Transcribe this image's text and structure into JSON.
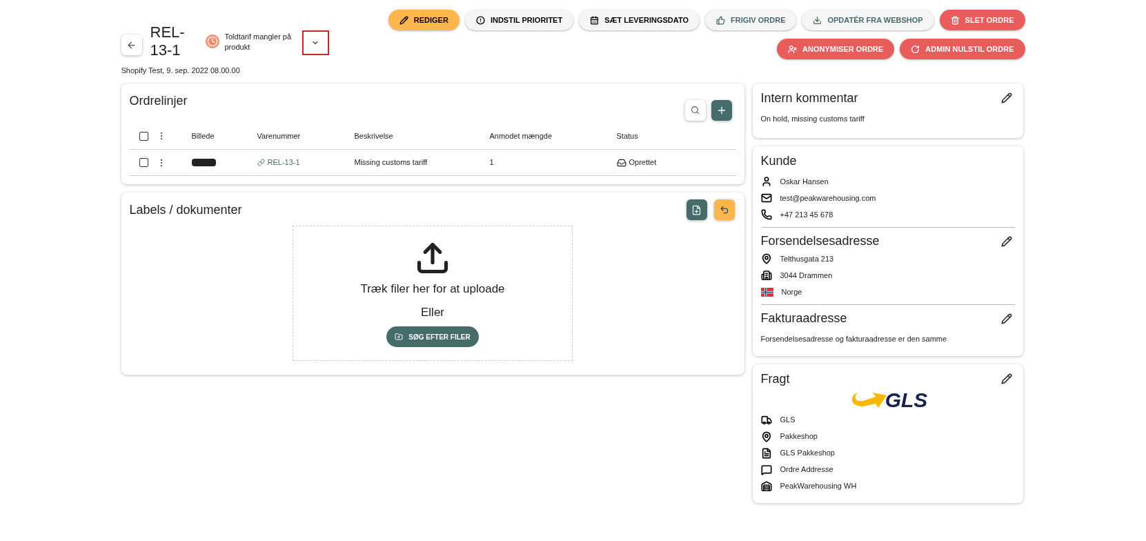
{
  "order": {
    "title": "REL-13-1",
    "status": "Toldtarif mangler på produkt",
    "source": "Shopify Test, 9. sep. 2022 08.00.00"
  },
  "actions": [
    {
      "label": "REDIGER",
      "kind": "warning",
      "disabled": false
    },
    {
      "label": "INDSTIL PRIORITET",
      "kind": "default",
      "disabled": false
    },
    {
      "label": "SÆT LEVERINGSDATO",
      "kind": "default",
      "disabled": false
    },
    {
      "label": "FRIGIV ORDRE",
      "kind": "default",
      "disabled": true
    },
    {
      "label": "OPDATÉR FRA WEBSHOP",
      "kind": "default",
      "disabled": true
    },
    {
      "label": "SLET ORDRE",
      "kind": "danger",
      "disabled": false
    },
    {
      "label": "ANONYMISER ORDRE",
      "kind": "danger",
      "disabled": false
    },
    {
      "label": "ADMIN NULSTIL ORDRE",
      "kind": "danger",
      "disabled": false
    }
  ],
  "order_lines": {
    "title": "Ordrelinjer",
    "columns": [
      "Billede",
      "Varenummer",
      "Beskrivelse",
      "Anmodet mængde",
      "Status"
    ],
    "header_checked": false,
    "rows": [
      {
        "checked": false,
        "sku": "REL-13-1",
        "description": "Missing customs tariff",
        "quantity": "1",
        "status": "Oprettet"
      }
    ]
  },
  "documents": {
    "title": "Labels / dokumenter",
    "drop_text": "Træk filer her for at uploade",
    "or_text": "Eller",
    "browse_button": "SØG EFTER FILER"
  },
  "internal_comment": {
    "title": "Intern kommentar",
    "text": "On hold, missing customs tariff"
  },
  "customer": {
    "title": "Kunde",
    "name": "Oskar Hansen",
    "email": "test@peakwarehousing.com",
    "phone": "+47 213 45 678"
  },
  "shipping_address": {
    "title": "Forsendelsesadresse",
    "street": "Telthusgata 213",
    "city": "3044 Drammen",
    "country": "Norge"
  },
  "billing_address": {
    "title": "Fakturaadresse",
    "text": "Forsendelsesadresse og fakturaadresse er den samme"
  },
  "freight": {
    "title": "Fragt",
    "logo_text": "GLS",
    "items": [
      "GLS",
      "Pakkeshop",
      "GLS Pakkeshop",
      "Ordre Addresse",
      "PeakWarehousing WH"
    ]
  }
}
